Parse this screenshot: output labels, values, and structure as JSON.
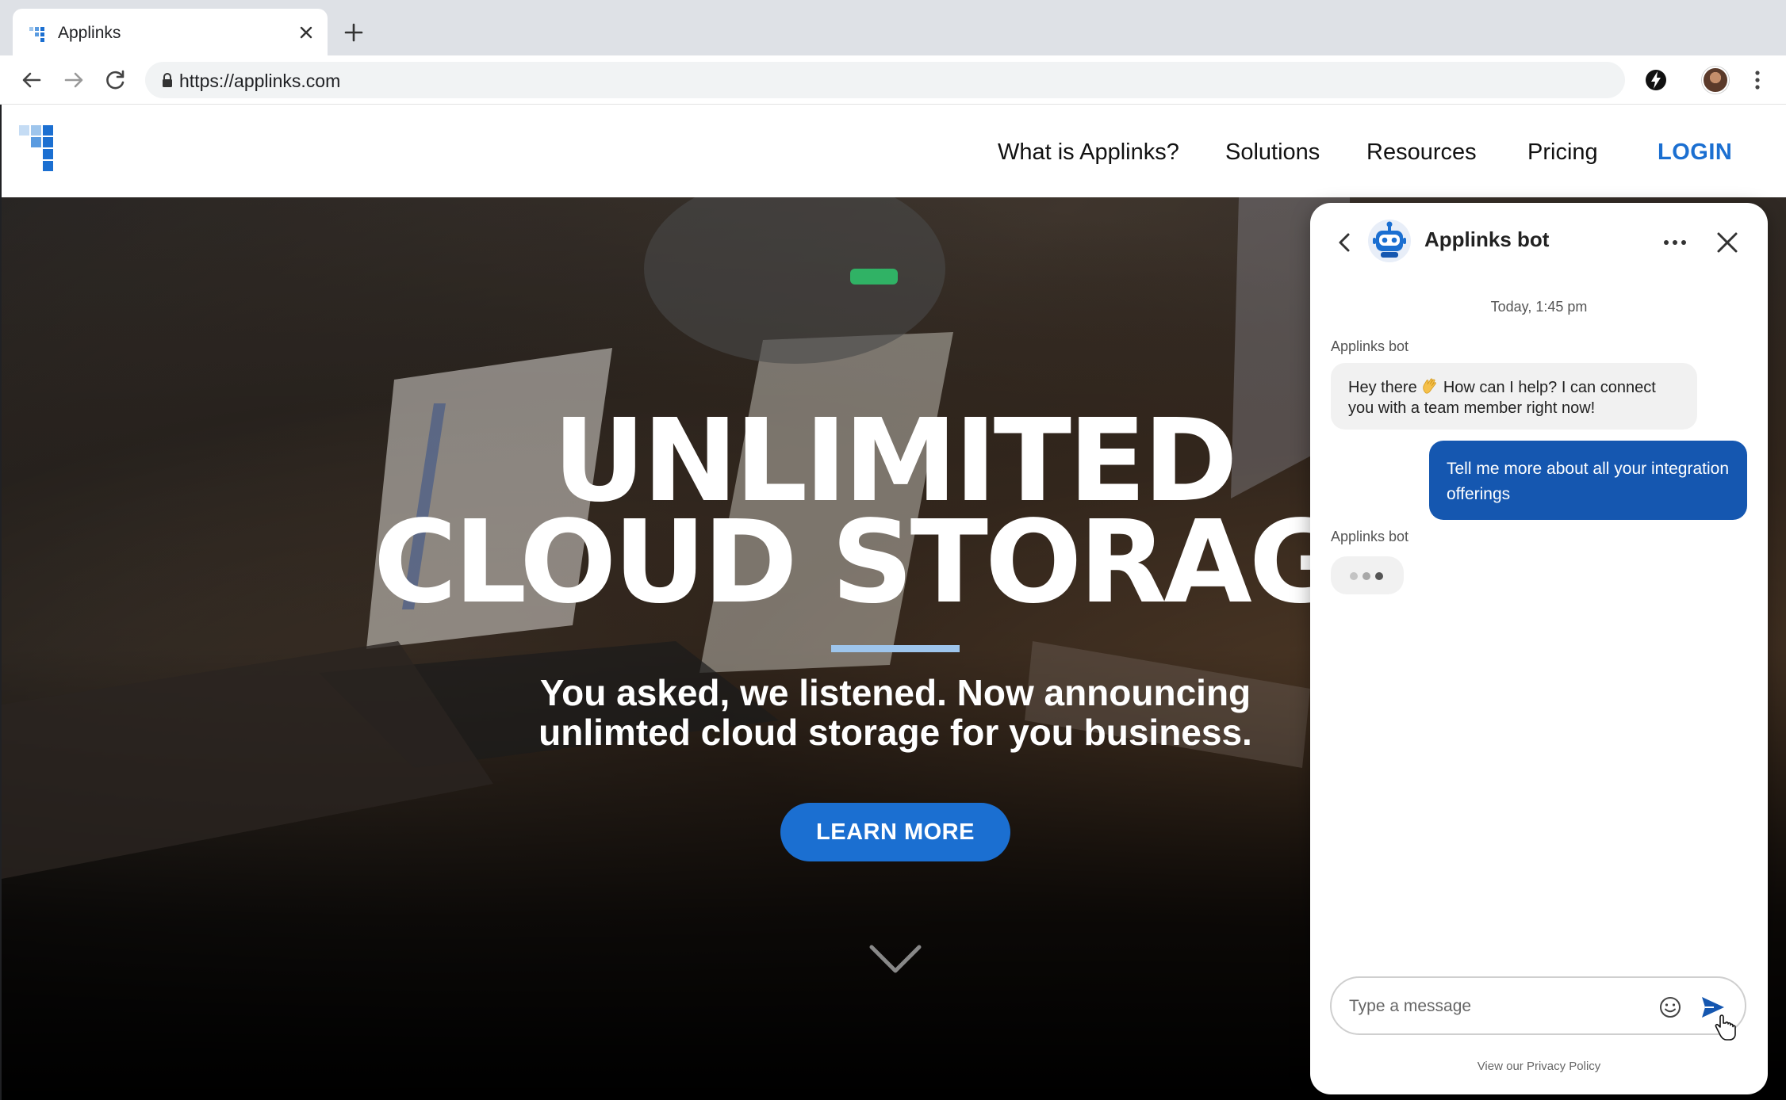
{
  "browser": {
    "tab_title": "Applinks",
    "url": "https://applinks.com"
  },
  "site": {
    "nav": {
      "what_is": "What is Applinks?",
      "solutions": "Solutions",
      "resources": "Resources",
      "pricing": "Pricing",
      "login": "LOGIN"
    },
    "brand_color": "#1b6fd1"
  },
  "hero": {
    "title_line1": "UNLIMITED",
    "title_line2": "CLOUD STORAGE",
    "subtitle": "You asked, we listened. Now announcing unlimted cloud storage for you business.",
    "cta": "LEARN MORE"
  },
  "chat": {
    "title": "Applinks bot",
    "date": "Today, 1:45 pm",
    "messages": [
      {
        "sender": "Applinks bot",
        "text_before": "Hey there",
        "text_after": " How can I help? I can connect you with a team member right now!"
      },
      {
        "sender": "user",
        "text": "Tell me more about all your integration offerings"
      },
      {
        "sender": "Applinks bot",
        "typing": true
      }
    ],
    "input_placeholder": "Type a message",
    "privacy": "View our Privacy Policy",
    "user_bubble_color": "#1557b0"
  }
}
